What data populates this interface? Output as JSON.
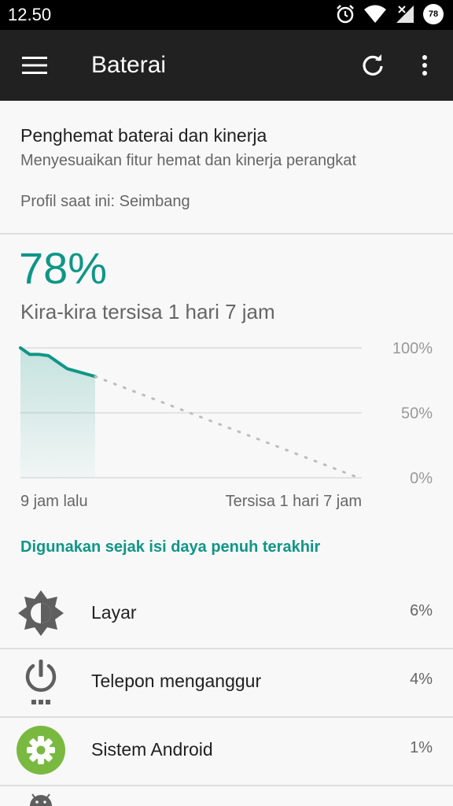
{
  "status_bar": {
    "time": "12.50",
    "battery_level": "78"
  },
  "toolbar": {
    "title": "Baterai",
    "menu_icon": "menu-icon",
    "refresh_icon": "refresh-icon",
    "overflow_icon": "more-vert-icon"
  },
  "battery_saver": {
    "title": "Penghemat baterai dan kinerja",
    "subtitle": "Menyesuaikan fitur hemat dan kinerja perangkat",
    "profile": "Profil saat ini: Seimbang"
  },
  "battery": {
    "percent": "78%",
    "remaining": "Kira-kira tersisa 1 hari 7 jam"
  },
  "chart_data": {
    "type": "line",
    "y_tick_labels": [
      "100%",
      "50%",
      "0%"
    ],
    "ylim": [
      0,
      100
    ],
    "x_start_label": "9 jam lalu",
    "x_end_label": "Tersisa 1 hari 7 jam",
    "series": [
      {
        "values": [
          100,
          95,
          95,
          94,
          89,
          84,
          82,
          80,
          78
        ]
      },
      {
        "values": [
          78,
          0
        ],
        "style": "dotted-projection"
      }
    ],
    "colors": {
      "line": "#0f9686",
      "projection": "#bdbdbd",
      "grid": "#dcdcdc"
    }
  },
  "usage": {
    "header": "Digunakan sejak isi daya penuh terakhir",
    "items": [
      {
        "label": "Layar",
        "value": "6%",
        "icon": "brightness-icon"
      },
      {
        "label": "Telepon menganggur",
        "value": "4%",
        "icon": "power-icon"
      },
      {
        "label": "Sistem Android",
        "value": "1%",
        "icon": "settings-gear-icon"
      }
    ]
  },
  "colors": {
    "accent": "#0f9686",
    "toolbar": "#212121",
    "status_bar": "#000000"
  }
}
